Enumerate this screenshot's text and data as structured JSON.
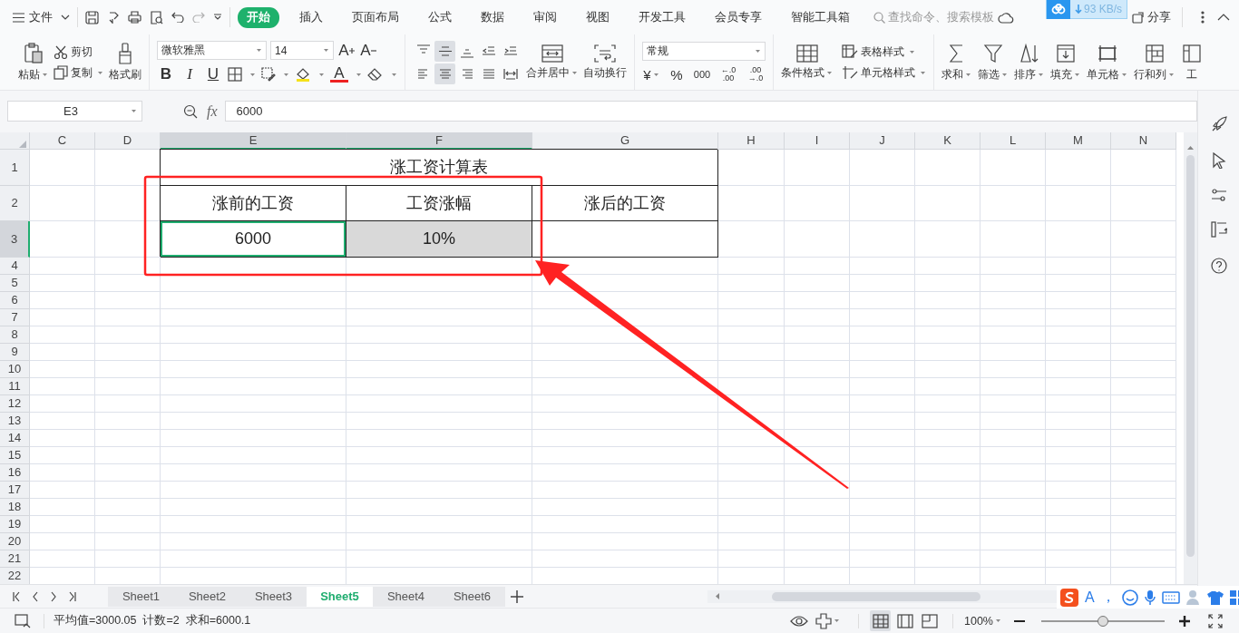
{
  "menu_bar": {
    "file_menu": "文件",
    "tabs": [
      {
        "label": "开始",
        "selected": true
      },
      {
        "label": "插入",
        "selected": false
      },
      {
        "label": "页面布局",
        "selected": false
      },
      {
        "label": "公式",
        "selected": false
      },
      {
        "label": "数据",
        "selected": false
      },
      {
        "label": "审阅",
        "selected": false
      },
      {
        "label": "视图",
        "selected": false
      },
      {
        "label": "开发工具",
        "selected": false
      },
      {
        "label": "会员专享",
        "selected": false
      },
      {
        "label": "智能工具箱",
        "selected": false
      }
    ],
    "search": {
      "placeholder": "查找命令、搜索模板"
    },
    "share": "分享"
  },
  "speed_widget": {
    "reading": "93 KB/s"
  },
  "ribbon": {
    "clipboard": {
      "paste": "粘贴",
      "cut": "剪切",
      "copy": "复制",
      "format_painter": "格式刷"
    },
    "font": {
      "name": "微软雅黑",
      "size": "14",
      "grow": "A",
      "shrink": "A",
      "bold": "B",
      "italic": "I",
      "underline": "U",
      "font_color": "A"
    },
    "alignment": {
      "buttons": [
        {
          "selected": false
        },
        {
          "selected": true
        },
        {
          "selected": false
        },
        {
          "selected": false
        },
        {
          "selected": false
        },
        {
          "selected": false
        },
        {
          "selected": true
        },
        {
          "selected": false
        },
        {
          "selected": false
        },
        {
          "selected": false
        }
      ],
      "merge": "合并居中",
      "wrap": "自动换行"
    },
    "number": {
      "format": "常规",
      "currency": "¥",
      "percent": "%",
      "thousands": "000",
      "increase_decimal": {
        "top": "←.0",
        "bottom": ".00"
      },
      "decrease_decimal": {
        "top": ".00",
        "bottom": "→.0"
      }
    },
    "styles": {
      "conditional": "条件格式",
      "table_style": "表格样式",
      "cell_style": "单元格样式"
    },
    "editing": [
      {
        "label": "求和"
      },
      {
        "label": "筛选"
      },
      {
        "label": "排序"
      },
      {
        "label": "填充"
      },
      {
        "label": "单元格"
      },
      {
        "label": "行和列"
      },
      {
        "label": "工"
      }
    ]
  },
  "formula_bar": {
    "name_box": "E3",
    "fx": "fx",
    "value": "6000"
  },
  "sheet": {
    "columns": [
      {
        "label": "C",
        "selected": false
      },
      {
        "label": "D",
        "selected": false
      },
      {
        "label": "E",
        "selected": true
      },
      {
        "label": "F",
        "selected": true
      },
      {
        "label": "G",
        "selected": false
      },
      {
        "label": "H",
        "selected": false
      },
      {
        "label": "I",
        "selected": false
      },
      {
        "label": "J",
        "selected": false
      },
      {
        "label": "K",
        "selected": false
      },
      {
        "label": "L",
        "selected": false
      },
      {
        "label": "M",
        "selected": false
      },
      {
        "label": "N",
        "selected": false
      }
    ],
    "rows": [
      {
        "number": "1",
        "selected": false,
        "cells": {
          "E": {
            "kind": "merged",
            "text": "涨工资计算表",
            "bordered": true
          }
        }
      },
      {
        "number": "2",
        "selected": false,
        "cells": {
          "E": {
            "text": "涨前的工资",
            "bordered": true
          },
          "F": {
            "text": "工资涨幅",
            "bordered": true
          },
          "G": {
            "text": "涨后的工资",
            "bordered": true
          }
        }
      },
      {
        "number": "3",
        "selected": true,
        "cells": {
          "E": {
            "text": "6000",
            "bordered": true,
            "selected": true,
            "active": true
          },
          "F": {
            "text": "10%",
            "bordered": true,
            "selected": true,
            "active": false
          },
          "G": {
            "bordered": true
          }
        }
      },
      {
        "number": "4",
        "selected": false
      },
      {
        "number": "5",
        "selected": false
      },
      {
        "number": "6",
        "selected": false
      },
      {
        "number": "7",
        "selected": false
      },
      {
        "number": "8",
        "selected": false
      },
      {
        "number": "9",
        "selected": false
      },
      {
        "number": "10",
        "selected": false
      },
      {
        "number": "11",
        "selected": false
      },
      {
        "number": "12",
        "selected": false
      },
      {
        "number": "13",
        "selected": false
      },
      {
        "number": "14",
        "selected": false
      },
      {
        "number": "15",
        "selected": false
      },
      {
        "number": "16",
        "selected": false
      },
      {
        "number": "17",
        "selected": false
      },
      {
        "number": "18",
        "selected": false
      },
      {
        "number": "19",
        "selected": false
      },
      {
        "number": "20",
        "selected": false
      },
      {
        "number": "21",
        "selected": false
      },
      {
        "number": "22",
        "selected": false
      }
    ]
  },
  "sheet_tabs": [
    {
      "label": "Sheet1",
      "selected": false
    },
    {
      "label": "Sheet2",
      "selected": false
    },
    {
      "label": "Sheet3",
      "selected": false
    },
    {
      "label": "Sheet5",
      "selected": true
    },
    {
      "label": "Sheet4",
      "selected": false
    },
    {
      "label": "Sheet6",
      "selected": false
    }
  ],
  "ime_toolbar": {
    "mode": "A",
    "punctuation": "，"
  },
  "status_bar": {
    "stats": [
      "平均值=3000.05",
      "计数=2",
      "求和=6000.1"
    ],
    "views": [
      {
        "selected": true
      },
      {
        "selected": false
      },
      {
        "selected": false
      }
    ],
    "zoom": "100%",
    "zoom_slider": {
      "level": 0.5
    }
  }
}
